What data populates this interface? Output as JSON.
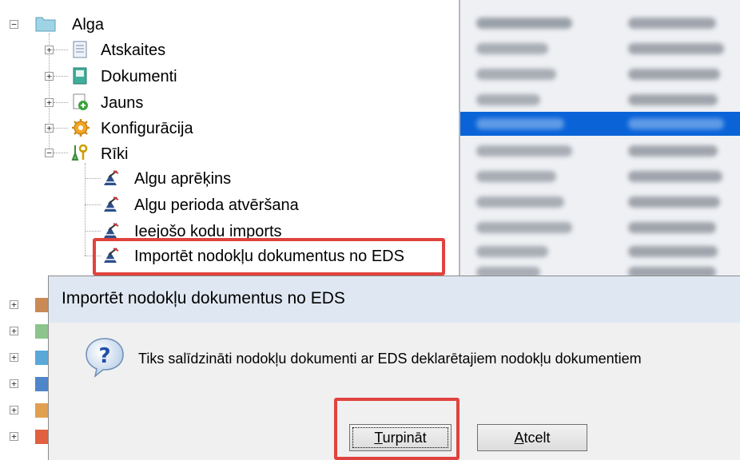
{
  "tree": {
    "root": {
      "label": "Alga",
      "icon": "folder-icon"
    },
    "items": [
      {
        "label": "Atskaites",
        "icon": "report-icon",
        "expander": "+"
      },
      {
        "label": "Dokumenti",
        "icon": "document-icon",
        "expander": "+"
      },
      {
        "label": "Jauns",
        "icon": "new-document-icon",
        "expander": "+"
      },
      {
        "label": "Konfigurācija",
        "icon": "gear-icon",
        "expander": "+"
      },
      {
        "label": "Rīki",
        "icon": "tools-icon",
        "expander": "−"
      }
    ],
    "tools": [
      {
        "label": "Algu aprēķins",
        "icon": "wizard-icon"
      },
      {
        "label": "Algu perioda atvēršana",
        "icon": "wizard-icon"
      },
      {
        "label": "Ieejošo kodu imports",
        "icon": "wizard-icon"
      },
      {
        "label": "Importēt nodokļu dokumentus no EDS",
        "icon": "wizard-icon"
      }
    ]
  },
  "dialog": {
    "title": "Importēt nodokļu dokumentus no EDS",
    "message": "Tiks salīdzināti nodokļu dokumenti ar EDS deklarētajiem nodokļu dokumentiem",
    "icon": "question-icon",
    "continue_button": {
      "accel": "T",
      "rest": "urpināt"
    },
    "cancel_button": {
      "accel": "A",
      "rest": "tcelt"
    }
  },
  "colors": {
    "highlight": "#e0433f",
    "selection": "#0a64d8"
  }
}
